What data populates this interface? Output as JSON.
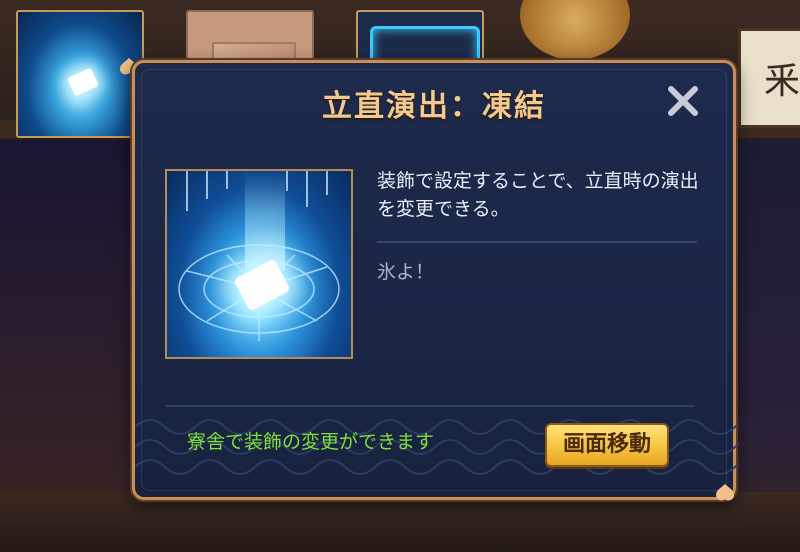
{
  "background": {
    "sign_text": "釆"
  },
  "thumbnails": [
    {
      "name": "freeze-effect",
      "selected": true
    },
    {
      "name": "envelope-effect",
      "selected": false
    },
    {
      "name": "cyber-frame-effect",
      "selected": false
    }
  ],
  "dialog": {
    "title": "立直演出：凍結",
    "description": "装飾で設定することで、立直時の演出を変更できる。",
    "quote": "氷よ！",
    "note": "寮舎で装飾の変更ができます",
    "go_button": "画面移動",
    "close_icon": "close-x-icon"
  },
  "colors": {
    "title": "#f2c98f",
    "note": "#7fe03a",
    "border": "#c98f56",
    "panel": "#1e2a4c",
    "button": "#f7c646"
  }
}
